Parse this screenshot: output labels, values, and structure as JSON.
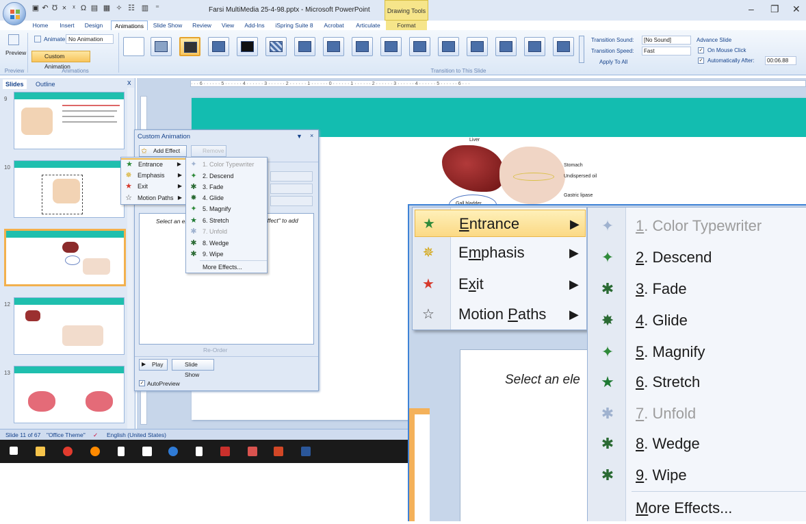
{
  "window": {
    "title": "Farsi MultiMedia 25-4-98.pptx - Microsoft PowerPoint",
    "contextual_tab": "Drawing Tools",
    "min": "–",
    "restore": "❐",
    "close": "✕"
  },
  "tabs": [
    "Home",
    "Insert",
    "Design",
    "Animations",
    "Slide Show",
    "Review",
    "View",
    "Add-Ins",
    "iSpring Suite 8",
    "Acrobat",
    "Articulate",
    "Format"
  ],
  "active_tab": "Animations",
  "ribbon": {
    "preview_label": "Preview",
    "preview_group": "Preview",
    "animate_label": "Animate:",
    "animate_value": "No Animation",
    "custom_animation": "Custom Animation",
    "animations_group": "Animations",
    "transition_group": "Transition to This Slide",
    "transition_sound_label": "Transition Sound:",
    "transition_sound_value": "[No Sound]",
    "transition_speed_label": "Transition Speed:",
    "transition_speed_value": "Fast",
    "apply_to_all": "Apply To All",
    "advance_slide": "Advance Slide",
    "on_mouse_click": "On Mouse Click",
    "auto_after": "Automatically After:",
    "auto_after_value": "00:06.88"
  },
  "left_pane": {
    "tab_slides": "Slides",
    "tab_outline": "Outline",
    "close": "x",
    "slide_numbers": [
      "9",
      "10",
      "11",
      "12",
      "13"
    ]
  },
  "ruler": "· · · 6 · · · · · · 5 · · · · · · 4 · · · · · · 3 · · · · · · 2 · · · · · · 1 · · · · · · 0 · · · · · · 1 · · · · · · 2 · · · · · · 3 · · · · · · 4 · · · · · · 5 · · · · · · 6 · · ·",
  "slide_labels": {
    "liver": "Liver",
    "stomach": "Stomach",
    "undispersed_oil": "Undispersed oil",
    "gastric_lipase": "Gastric lipase",
    "gall_bladder": "Gall bladder"
  },
  "status": {
    "slide_info": "Slide 11 of 67",
    "theme": "\"Office Theme\"",
    "language": "English (United States)"
  },
  "custom_animation": {
    "title": "Custom Animation",
    "add_effect": "Add Effect",
    "remove": "Remove",
    "list_hint": "Select an ele",
    "list_hint_end": "Effect\" to add",
    "reorder": "Re-Order",
    "play": "Play",
    "slide_show": "Slide Show",
    "autopreview": "AutoPreview"
  },
  "effect_menu": {
    "items": [
      {
        "label": "Entrance",
        "icon": "entrance-star-icon",
        "accel": "E"
      },
      {
        "label": "Emphasis",
        "icon": "emphasis-star-icon",
        "accel": "m"
      },
      {
        "label": "Exit",
        "icon": "exit-star-icon",
        "accel": "x"
      },
      {
        "label": "Motion Paths",
        "icon": "motion-path-star-icon",
        "accel": "P"
      }
    ]
  },
  "entrance_submenu": {
    "items": [
      {
        "num": "1",
        "label": "Color Typewriter",
        "disabled": true
      },
      {
        "num": "2",
        "label": "Descend",
        "disabled": false
      },
      {
        "num": "3",
        "label": "Fade",
        "disabled": false
      },
      {
        "num": "4",
        "label": "Glide",
        "disabled": false
      },
      {
        "num": "5",
        "label": "Magnify",
        "disabled": false
      },
      {
        "num": "6",
        "label": "Stretch",
        "disabled": false
      },
      {
        "num": "7",
        "label": "Unfold",
        "disabled": true
      },
      {
        "num": "8",
        "label": "Wedge",
        "disabled": false
      },
      {
        "num": "9",
        "label": "Wipe",
        "disabled": false
      }
    ],
    "more": "More Effects..."
  },
  "zoom": {
    "select_text": "Select an ele"
  },
  "colors": {
    "teal": "#13bdb0",
    "highlight": "#fbd985",
    "ribbon": "#dbe7f6"
  }
}
